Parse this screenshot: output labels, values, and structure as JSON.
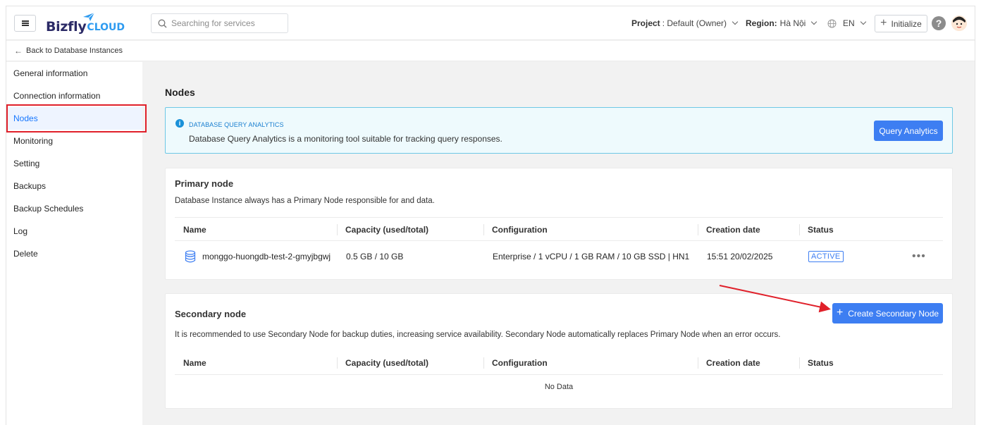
{
  "header": {
    "logo_text": "Bizfly",
    "logo_sub": "CLOUD",
    "search_placeholder": "Searching for services",
    "project_label": "Project",
    "project_value": ": Default (Owner)",
    "region_label": "Region:",
    "region_value": "Hà Nội",
    "language": "EN",
    "initialize_label": "Initialize",
    "help": "?"
  },
  "breadcrumb": {
    "back_label": "Back to Database Instances"
  },
  "sidebar": {
    "items": [
      {
        "label": "General information"
      },
      {
        "label": "Connection information"
      },
      {
        "label": "Nodes"
      },
      {
        "label": "Monitoring"
      },
      {
        "label": "Setting"
      },
      {
        "label": "Backups"
      },
      {
        "label": "Backup Schedules"
      },
      {
        "label": "Log"
      },
      {
        "label": "Delete"
      }
    ],
    "active_index": 2
  },
  "main": {
    "title": "Nodes",
    "banner": {
      "title": "DATABASE QUERY ANALYTICS",
      "description": "Database Query Analytics is a monitoring tool suitable for tracking query responses.",
      "button_label": "Query Analytics"
    },
    "primary": {
      "title": "Primary node",
      "description": "Database Instance always has a Primary Node responsible for and data.",
      "columns": [
        "Name",
        "Capacity (used/total)",
        "Configuration",
        "Creation date",
        "Status"
      ],
      "rows": [
        {
          "name": "monggo-huongdb-test-2-gmyjbgwj",
          "capacity": "0.5 GB / 10 GB",
          "configuration": "Enterprise / 1 vCPU / 1 GB RAM / 10 GB SSD | HN1",
          "created": "15:51 20/02/2025",
          "status": "ACTIVE"
        }
      ]
    },
    "secondary": {
      "title": "Secondary node",
      "description": "It is recommended to use Secondary Node for backup duties, increasing service availability. Secondary Node automatically replaces Primary Node when an error occurs.",
      "button_label": "Create Secondary Node",
      "columns": [
        "Name",
        "Capacity (used/total)",
        "Configuration",
        "Creation date",
        "Status"
      ],
      "empty_text": "No Data"
    }
  },
  "colors": {
    "accent": "#3d7ef2",
    "highlight_box": "#e0202a",
    "banner_bg": "#eefafd"
  }
}
